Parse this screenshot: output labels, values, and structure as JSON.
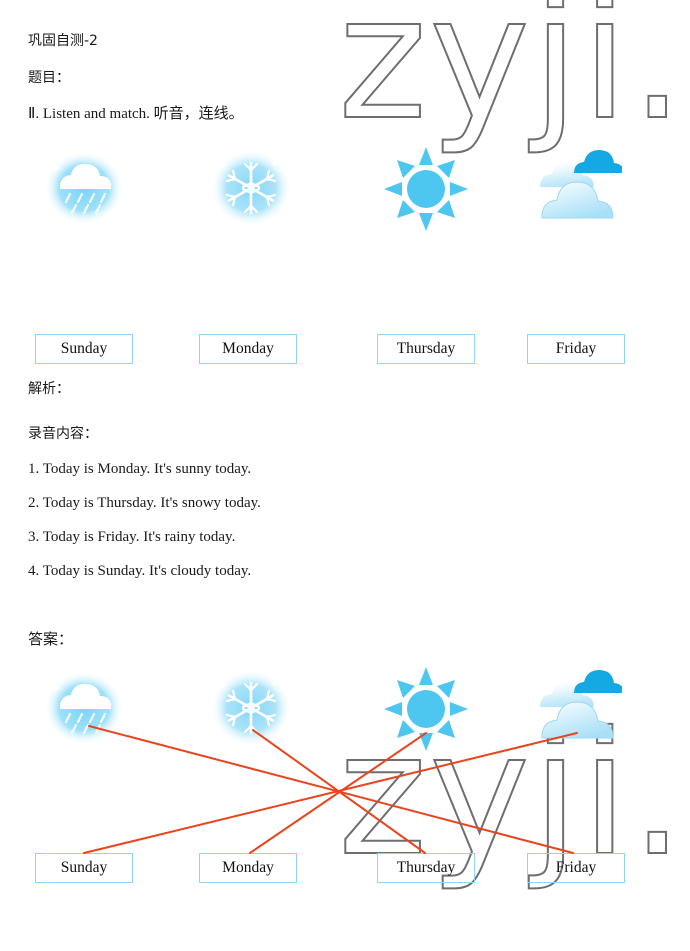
{
  "document": {
    "title": "巩固自测-2",
    "section_question_label": "题目：",
    "question_text": "Ⅱ. Listen and match. 听音，连线。",
    "section_analysis_label": "解析：",
    "recording_label": "录音内容：",
    "recording_items": [
      "1. Today is Monday. It's sunny today.",
      "2. Today is Thursday. It's snowy today.",
      "3. Today is Friday. It's rainy today.",
      "4. Today is Sunday. It's cloudy today."
    ],
    "section_answer_label": "答案："
  },
  "watermark": {
    "text": "zyji.c"
  },
  "weather_icons": [
    {
      "id": "rainy",
      "name": "rainy-weather-icon",
      "label": "rainy"
    },
    {
      "id": "snowy",
      "name": "snowy-weather-icon",
      "label": "snowy"
    },
    {
      "id": "sunny",
      "name": "sunny-weather-icon",
      "label": "sunny"
    },
    {
      "id": "cloudy",
      "name": "cloudy-weather-icon",
      "label": "cloudy"
    }
  ],
  "day_labels": [
    {
      "text": "Sunday"
    },
    {
      "text": "Monday"
    },
    {
      "text": "Thursday"
    },
    {
      "text": "Friday"
    }
  ],
  "answer_matches": [
    {
      "from": "rainy",
      "to": "Friday"
    },
    {
      "from": "snowy",
      "to": "Thursday"
    },
    {
      "from": "sunny",
      "to": "Monday"
    },
    {
      "from": "cloudy",
      "to": "Sunday"
    }
  ],
  "colors": {
    "line": "#e8451f",
    "box_border": "#8fd4f2",
    "icon_blue": "#4ec7f0",
    "icon_deep_blue": "#10a5e0",
    "watermark": "#6e6e6e"
  }
}
